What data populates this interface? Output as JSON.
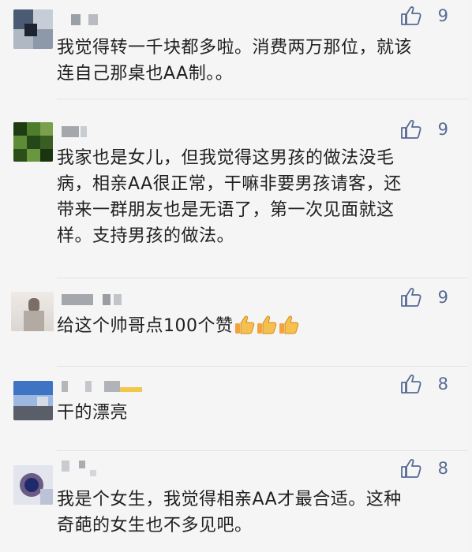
{
  "comments": [
    {
      "likes": "9",
      "text": "我觉得转一千块都多啦。消费两万那位，就该连自己那桌也AA制。。",
      "avatar_colors": [
        "#4b5b74",
        "#8d98a9",
        "#1d2330",
        "#c7cdd6"
      ]
    },
    {
      "likes": "9",
      "text": "我家也是女儿，但我觉得这男孩的做法没毛病，相亲AA很正常，干嘛非要男孩请客，还带来一群朋友也是无语了，第一次见面就这样。支持男孩的做法。",
      "avatar_colors": [
        "#1f3b13",
        "#3f6b23",
        "#7aa04b",
        "#244818"
      ]
    },
    {
      "likes": "9",
      "text": "给这个帅哥点100个赞",
      "emoji_count": "3",
      "avatar_colors": [
        "#dad6d2",
        "#b3aaa3",
        "#7c6e66",
        "#efeae5"
      ]
    },
    {
      "likes": "8",
      "text": "干的漂亮",
      "avatar_colors": [
        "#3e74c2",
        "#9cb8e0",
        "#5a5e68",
        "#d4dce7"
      ]
    },
    {
      "likes": "8",
      "text": "我是个女生，我觉得相亲AA才最合适。这种奇葩的女生也不多见吧。",
      "avatar_colors": [
        "#1f2a6b",
        "#bcc3d7",
        "#6a5c84",
        "#e3e5ee"
      ]
    }
  ],
  "colors": {
    "like_blue": "#576b95",
    "text": "#1f1f1f",
    "background": "#f5f5f5"
  }
}
